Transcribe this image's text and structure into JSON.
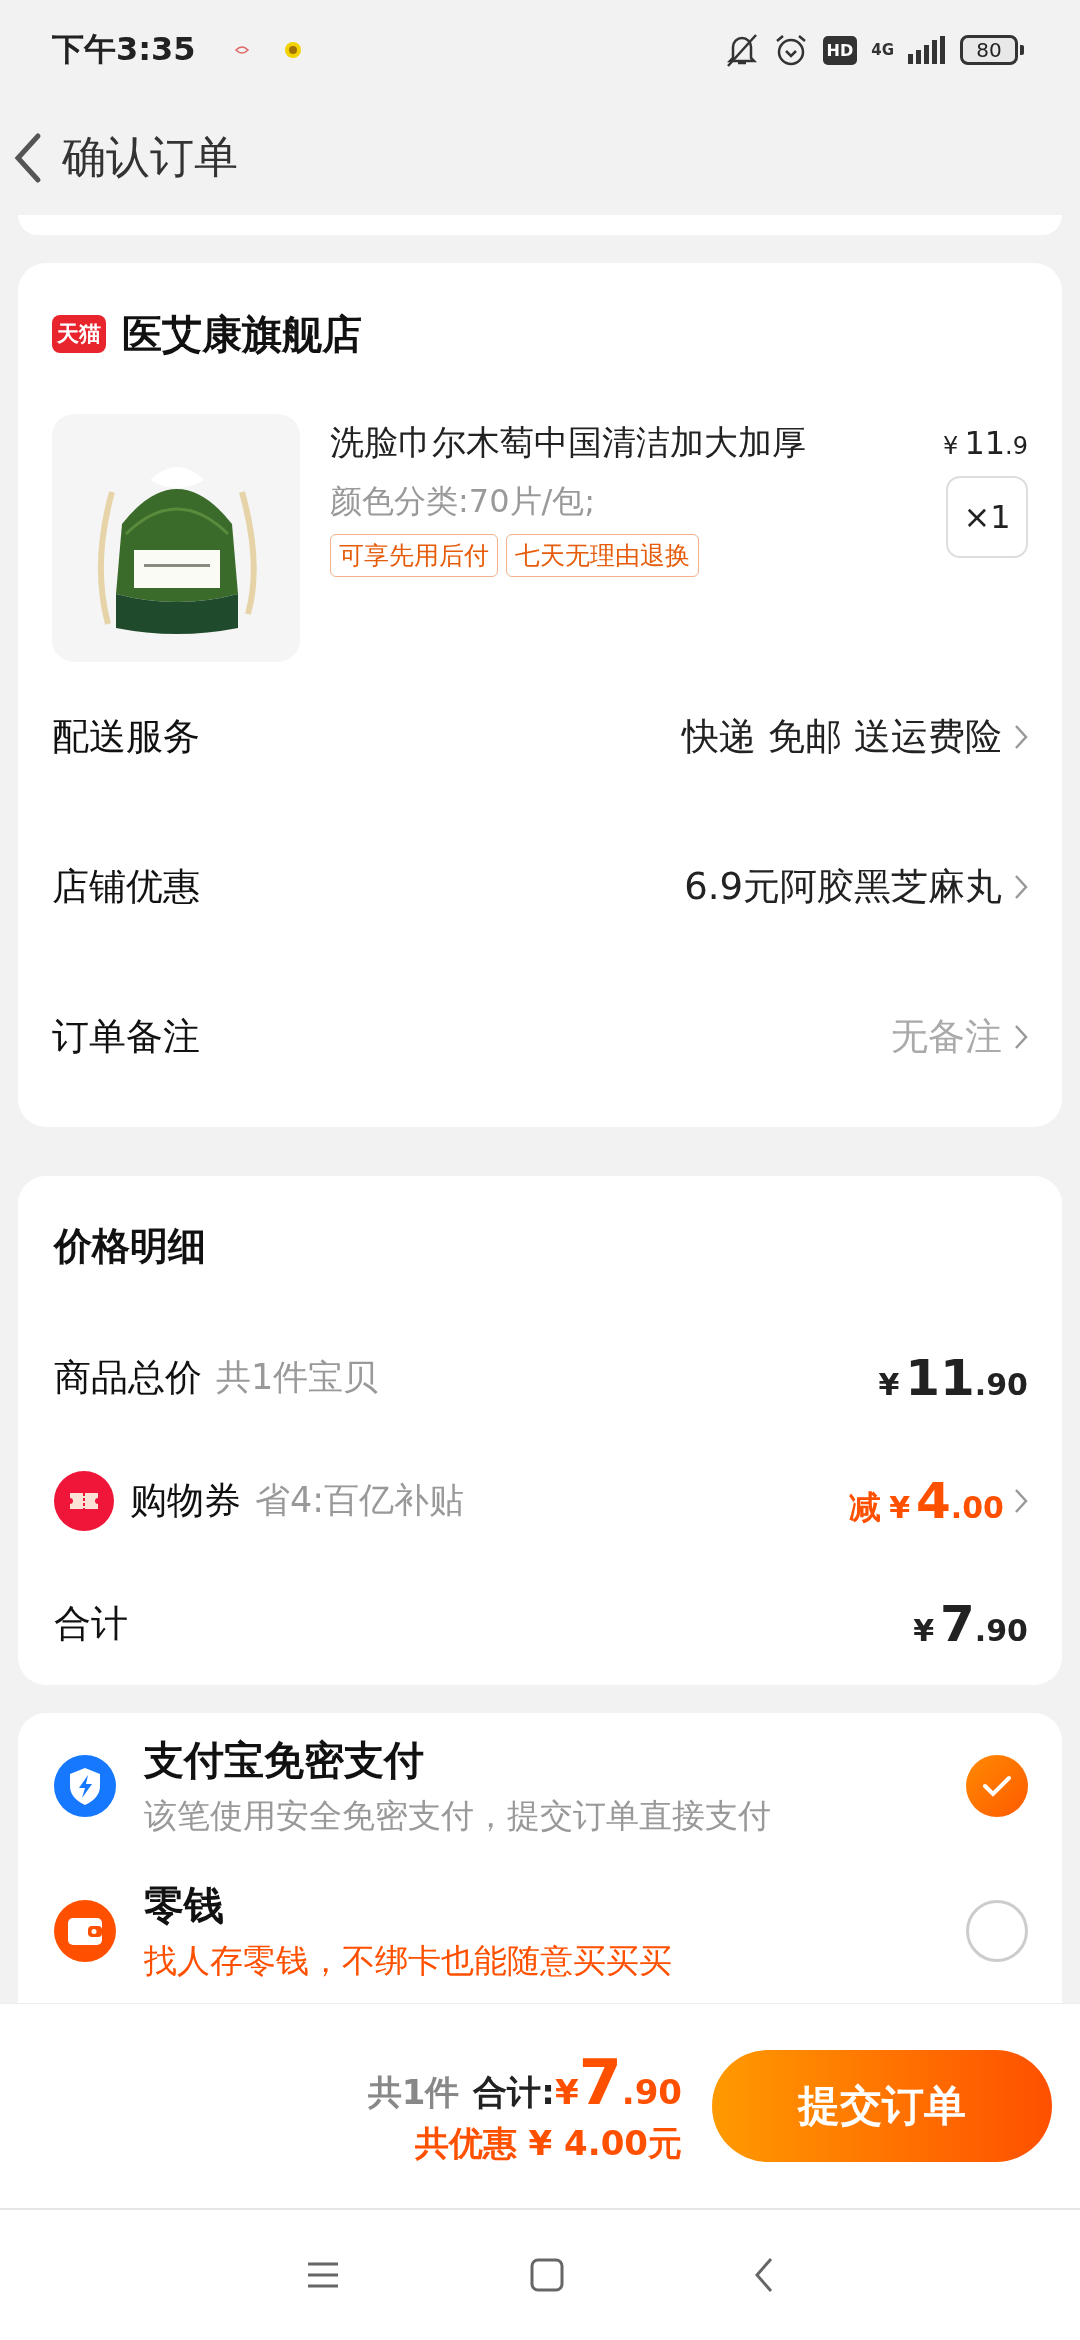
{
  "status_bar": {
    "time": "下午3:35",
    "hd": "HD",
    "network": "4G",
    "battery": "80"
  },
  "header": {
    "title": "确认订单"
  },
  "store": {
    "logo": "天猫",
    "name": "医艾康旗舰店",
    "product": {
      "title": "洗脸巾尔木萄中国清洁加大加厚",
      "currency": "¥",
      "price_int": "11",
      "price_dec": ".9",
      "spec": "颜色分类:70片/包;",
      "tags": [
        "可享先用后付",
        "七天无理由退换"
      ],
      "quantity": "×1"
    },
    "rows": [
      {
        "label": "配送服务",
        "value": "快递 免邮 送运费险",
        "muted": false
      },
      {
        "label": "店铺优惠",
        "value": "6.9元阿胶黑芝麻丸",
        "muted": false
      },
      {
        "label": "订单备注",
        "value": "无备注",
        "muted": true
      }
    ]
  },
  "price_detail": {
    "title": "价格明细",
    "rows": [
      {
        "kind": "plain",
        "label": "商品总价",
        "note": "共1件宝贝",
        "currency": "¥",
        "int": "11",
        "dec": ".90"
      },
      {
        "kind": "coupon",
        "label": "购物券",
        "note": "省4:百亿补贴",
        "prefix": "减",
        "currency": "¥",
        "int": "4",
        "dec": ".00"
      },
      {
        "kind": "plain",
        "label": "合计",
        "currency": "¥",
        "int": "7",
        "dec": ".90"
      }
    ]
  },
  "payment": [
    {
      "kind": "alipay",
      "title": "支付宝免密支付",
      "subtitle": "该笔使用安全免密支付，提交订单直接支付",
      "selected": true
    },
    {
      "kind": "wallet",
      "title": "零钱",
      "subtitle": "找人存零钱，不绑卡也能随意买买买",
      "selected": false
    }
  ],
  "footer": {
    "count": "共1件",
    "total_label": "合计:",
    "currency": "¥",
    "int": "7",
    "dec": ".90",
    "discount": "共优惠 ¥ 4.00元",
    "submit": "提交订单"
  }
}
